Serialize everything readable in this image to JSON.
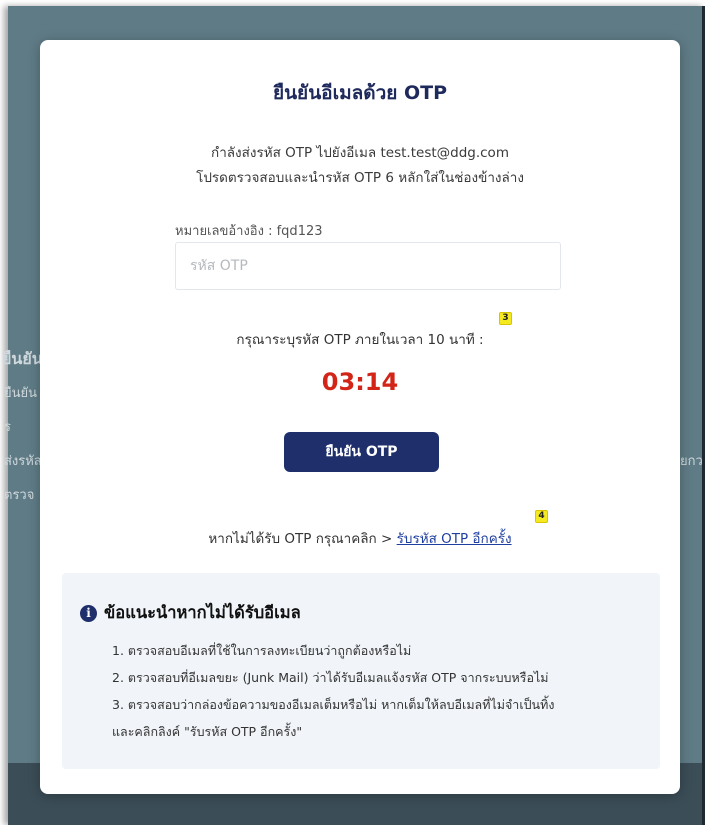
{
  "backdrop": {
    "lines": [
      "ยืนยันอีเมล",
      "ยืนยัน",
      "ร",
      "ส่งรหัส",
      "ตรวจ"
    ],
    "right_text": "ยกว"
  },
  "modal": {
    "title": "ยืนยันอีเมลด้วย OTP",
    "subtitle_line1": "กำลังส่งรหัส OTP ไปยังอีเมล test.test@ddg.com",
    "subtitle_line2": "โปรดตรวจสอบและนำรหัส OTP 6 หลักใส่ในช่องข้างล่าง",
    "reference": "หมายเลขอ้างอิง : fqd123",
    "otp_input": {
      "value": "",
      "placeholder": "รหัส OTP"
    },
    "timer_label": "กรุณาระบุรหัส OTP ภายในเวลา 10 นาที :",
    "countdown": "03:14",
    "confirm_label": "ยืนยัน OTP",
    "resend_prompt": "หากไม่ได้รับ OTP กรุณาคลิก >",
    "resend_link": "รับรหัส OTP อีกครั้ง",
    "badges": {
      "timer": "3",
      "resend": "4"
    }
  },
  "tips": {
    "icon": "info-icon",
    "heading": "ข้อแนะนำหากไม่ได้รับอีเมล",
    "items": [
      "1. ตรวจสอบอีเมลที่ใช้ในการลงทะเบียนว่าถูกต้องหรือไม่",
      "2. ตรวจสอบที่อีเมลขยะ (Junk Mail) ว่าได้รับอีเมลแจ้งรหัส OTP จากระบบหรือไม่",
      "3. ตรวจสอบว่ากล่องข้อความของอีเมลเต็มหรือไม่ หากเต็มให้ลบอีเมลที่ไม่จำเป็นทิ้ง",
      "และคลิกลิงค์ \"รับรหัส OTP อีกครั้ง\""
    ]
  },
  "colors": {
    "title": "#1f2a5c",
    "button": "#1f2f6c",
    "countdown": "#d32418",
    "link": "#1f3fa0",
    "tips_bg": "#f1f5f9",
    "badge": "#f5ea1f",
    "backdrop": "#5f7b86"
  }
}
